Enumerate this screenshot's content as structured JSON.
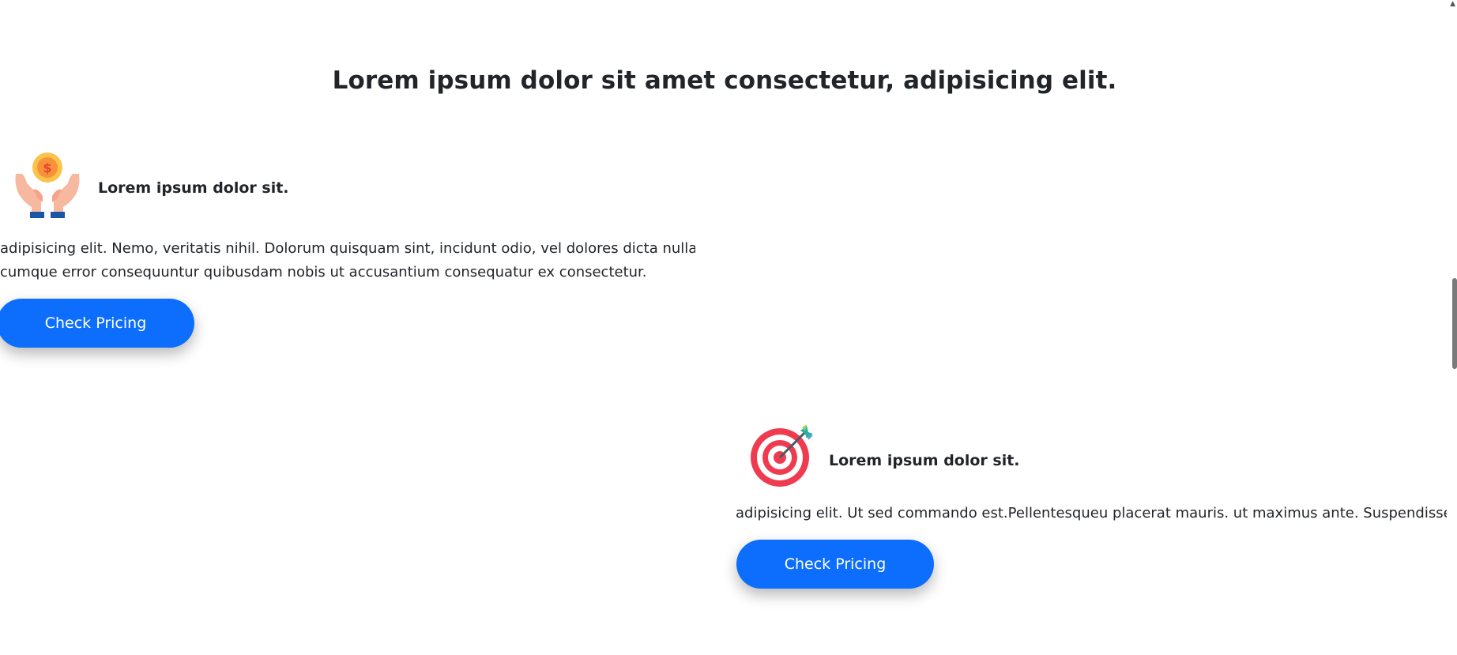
{
  "section": {
    "heading": "Lorem ipsum dolor sit amet consectetur, adipisicing elit."
  },
  "features": [
    {
      "icon": "hands-coin-icon",
      "title": "Lorem ipsum dolor sit.",
      "body_line1": "adipisicing elit. Nemo, veritatis nihil. Dolorum quisquam sint, incidunt odio, vel dolores dicta nulla",
      "body_line2": "cumque error consequuntur quibusdam nobis ut accusantium consequatur ex consectetur.",
      "button_label": "Check Pricing"
    },
    {
      "icon": "target-dart-icon",
      "title": "Lorem ipsum dolor sit.",
      "body_line1": "adipisicing elit. Ut sed commando est.Pellentesqueu placerat mauris. ut maximus ante. Suspendisse",
      "button_label": "Check Pricing"
    }
  ],
  "colors": {
    "primary_button": "#0d6efd",
    "text": "#212529",
    "background": "#ffffff"
  }
}
